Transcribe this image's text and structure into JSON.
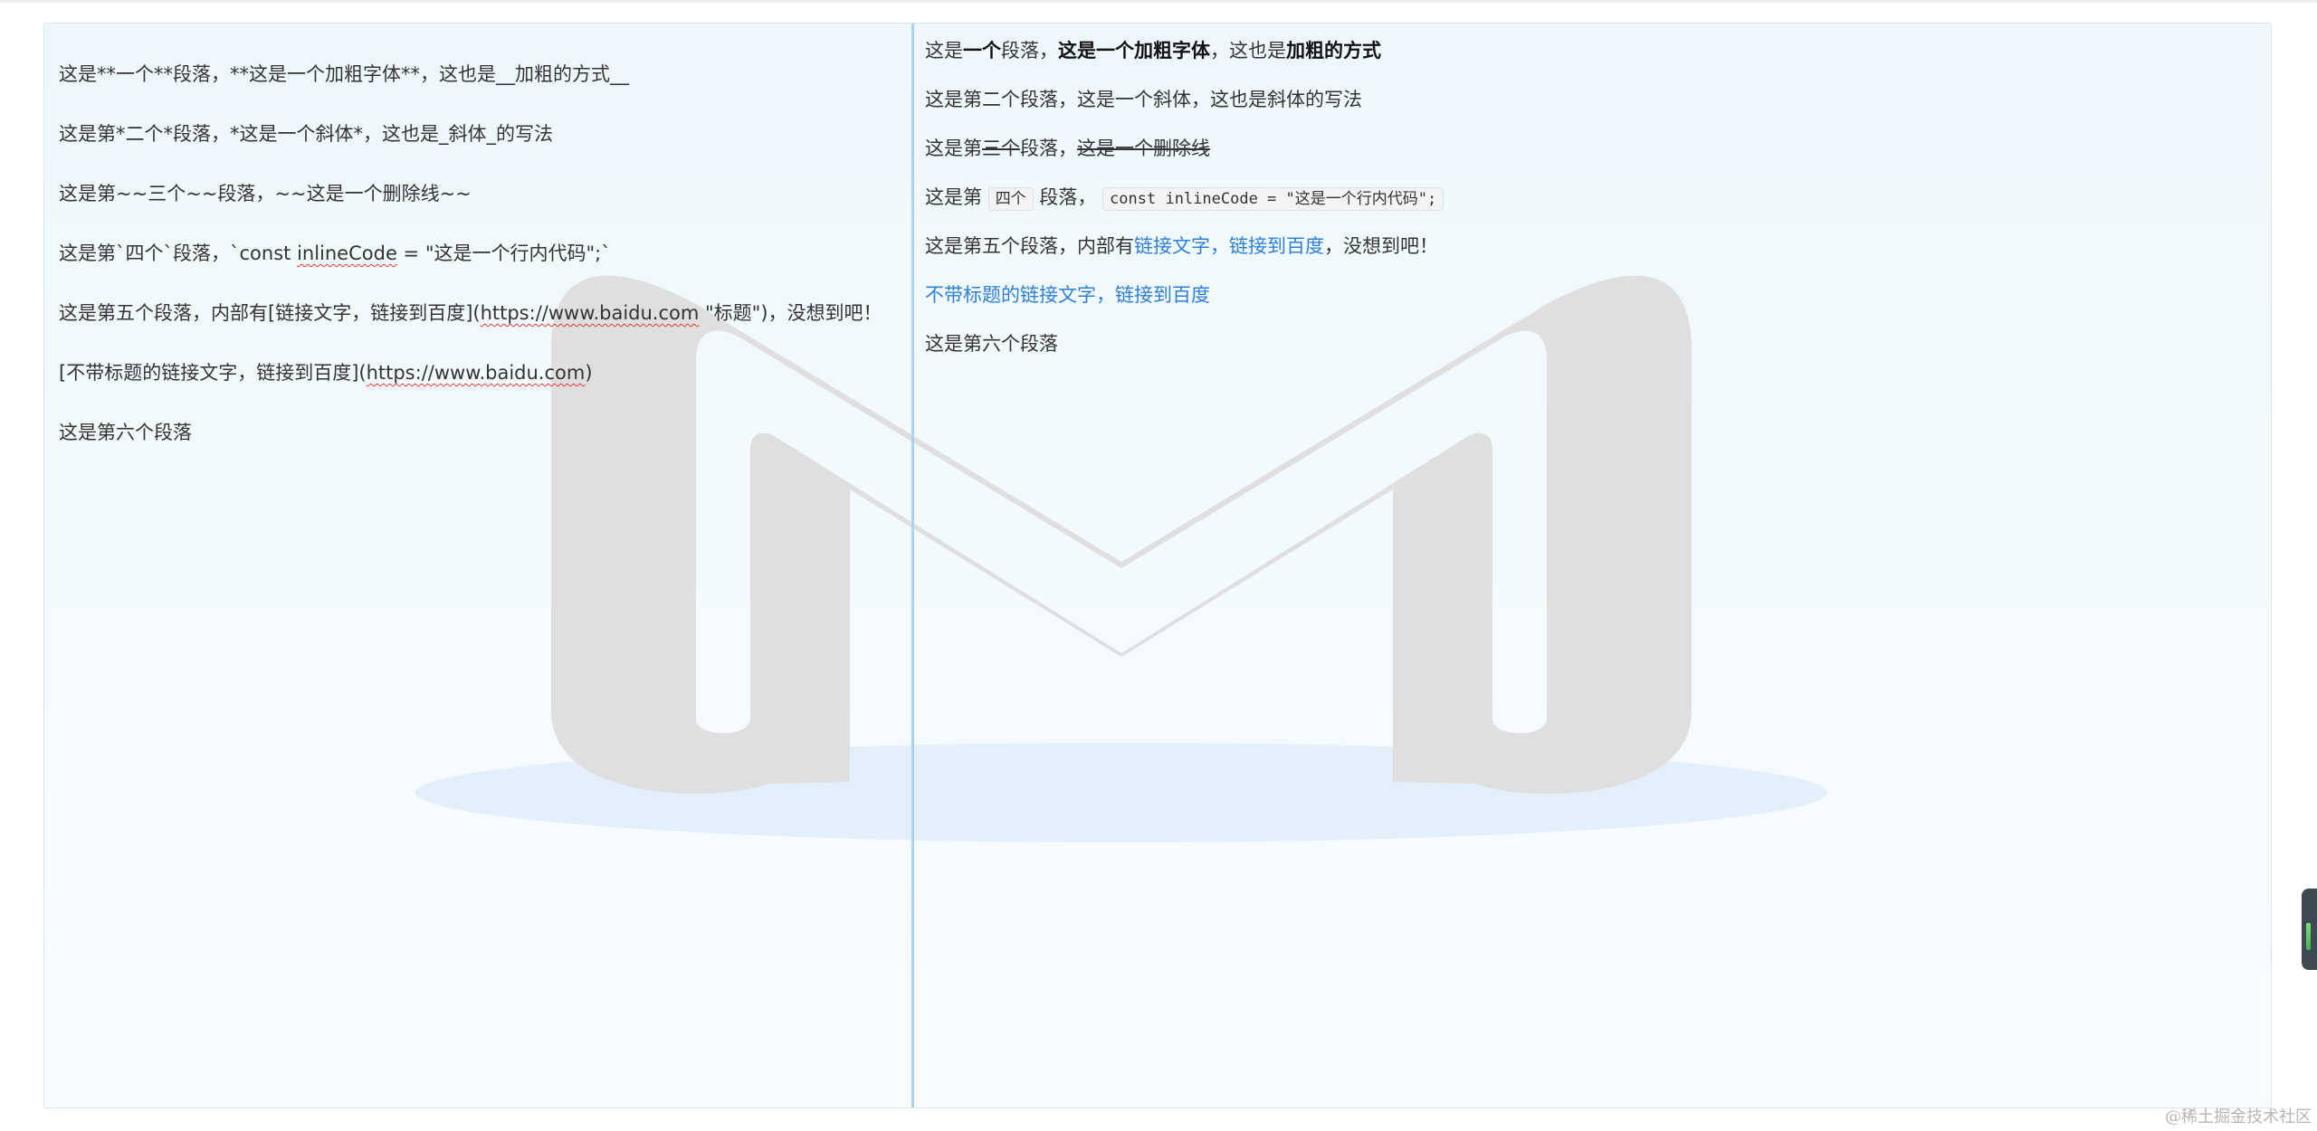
{
  "editor": {
    "source_lines": [
      "这是**一个**段落，**这是一个加粗字体**，这也是__加粗的方式__",
      "这是第*二个*段落，*这是一个斜体*，这也是_斜体_的写法",
      "这是第~~三个~~段落，~~这是一个删除线~~",
      {
        "before": "这是第`四个`段落，`const ",
        "squiggle": "inlineCode",
        "after": " = \"这是一个行内代码\";`"
      },
      {
        "before": "这是第五个段落，内部有[链接文字，链接到百度](",
        "squiggle": "https://www.baidu.com",
        "after": " \"标题\")，没想到吧！"
      },
      {
        "before": "[不带标题的链接文字，链接到百度](",
        "squiggle": "https://www.baidu.com",
        "after": ")"
      },
      "这是第六个段落"
    ]
  },
  "preview": {
    "p1": {
      "a": "这是",
      "b": "一个",
      "c": "段落，",
      "d": "这是一个加粗字体",
      "e": "，这也是",
      "f": "加粗的方式"
    },
    "p2": {
      "text": "这是第二个段落，这是一个斜体，这也是斜体的写法"
    },
    "p3": {
      "a": "这是第",
      "b": "三个",
      "c": "段落，",
      "d": "这是一个删除线"
    },
    "p4": {
      "a": "这是第 ",
      "code1": "四个",
      "b": " 段落， ",
      "code2": "const inlineCode = \"这是一个行内代码\";"
    },
    "p5": {
      "a": "这是第五个段落，内部有",
      "link": "链接文字，链接到百度",
      "b": "，没想到吧！"
    },
    "p6": {
      "link": "不带标题的链接文字，链接到百度"
    },
    "p7": {
      "text": "这是第六个段落"
    }
  },
  "watermark_text": "@稀土掘金技术社区",
  "colors": {
    "link": "#2f7fd6",
    "divider": "#a9d3ef",
    "spellcheck": "#e53935"
  }
}
